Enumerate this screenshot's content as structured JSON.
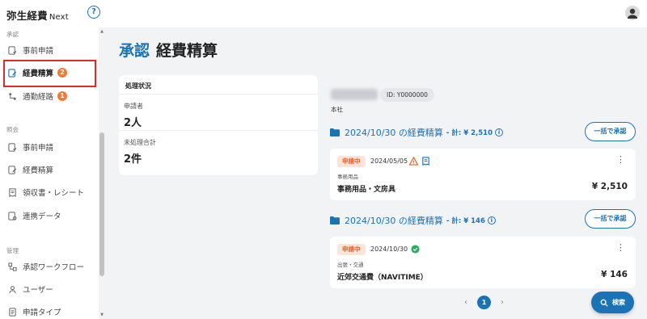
{
  "app": {
    "logo_main": "弥生経費",
    "logo_sub": "Next",
    "help_label": "?"
  },
  "sidebar": {
    "sections": [
      {
        "label": "承認"
      },
      {
        "label": "照会"
      },
      {
        "label": "管理"
      }
    ],
    "approve_items": [
      {
        "label": "事前申請"
      },
      {
        "label": "経費精算",
        "badge": "2"
      },
      {
        "label": "通勤経路",
        "badge": "1"
      }
    ],
    "inquiry_items": [
      {
        "label": "事前申請"
      },
      {
        "label": "経費精算"
      },
      {
        "label": "領収書・レシート"
      },
      {
        "label": "連携データ"
      }
    ],
    "admin_items": [
      {
        "label": "承認ワークフロー"
      },
      {
        "label": "ユーザー"
      },
      {
        "label": "申請タイプ"
      }
    ]
  },
  "page": {
    "title_accent": "承認",
    "title": "経費精算"
  },
  "status_card": {
    "header": "処理状況",
    "rows": [
      {
        "label": "申請者",
        "value": "2人"
      },
      {
        "label": "未処理合計",
        "value": "2件"
      }
    ]
  },
  "applicant": {
    "id": "ID: Y0000000",
    "dept": "本社"
  },
  "groups": [
    {
      "date": "2024/10/30 の経費精算",
      "total": "- 計: ¥ 2,510",
      "bulk_label": "一括で承認",
      "expense": {
        "status": "申請中",
        "date": "2024/05/05",
        "category": "事務用品",
        "name": "事務用品・文房具",
        "amount": "¥ 2,510"
      }
    },
    {
      "date": "2024/10/30 の経費精算",
      "total": "- 計: ¥ 146",
      "bulk_label": "一括で承認",
      "expense": {
        "status": "申請中",
        "date": "2024/10/30",
        "category": "出張・交通",
        "name": "近郊交通費（NAVITIME）",
        "amount": "¥ 146"
      }
    }
  ],
  "pagination": {
    "current": "1",
    "prev": "‹",
    "next": "›"
  },
  "search_button": {
    "label": "検索"
  },
  "colors": {
    "accent": "#1a73b5",
    "badge": "#f07a38",
    "highlight": "#e02a2a",
    "warning": "#e0622a",
    "success": "#27ae60"
  }
}
